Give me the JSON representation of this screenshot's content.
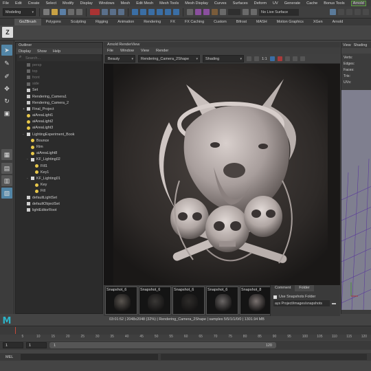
{
  "menubar": {
    "items": [
      "File",
      "Edit",
      "Create",
      "Select",
      "Modify",
      "Display",
      "Windows",
      "Mesh",
      "Edit Mesh",
      "Mesh Tools",
      "Mesh Display",
      "Curves",
      "Surfaces",
      "Deform",
      "UV",
      "Generate",
      "Cache",
      "Bonus Tools",
      "Arnold",
      "Help"
    ]
  },
  "statusline": {
    "workspace": "Modeling",
    "live_surface": "No Live Surface"
  },
  "shelf": {
    "tabs": [
      "GoZBrush",
      "Polygons",
      "Sculpting",
      "Rigging",
      "Animation",
      "Rendering",
      "FX",
      "FX Caching",
      "Custom",
      "Bifrost",
      "MASH",
      "Motion Graphics",
      "XGen",
      "Arnold"
    ],
    "active_tab": "GoZBrush"
  },
  "outliner": {
    "title": "Outliner",
    "menu": [
      "Display",
      "Show",
      "Help"
    ],
    "search_placeholder": "Search...",
    "items": [
      {
        "label": "persp",
        "dim": true,
        "indent": 0,
        "icon": "camera"
      },
      {
        "label": "top",
        "dim": true,
        "indent": 0,
        "icon": "camera"
      },
      {
        "label": "front",
        "dim": true,
        "indent": 0,
        "icon": "camera"
      },
      {
        "label": "side",
        "dim": true,
        "indent": 0,
        "icon": "camera"
      },
      {
        "label": "Set",
        "dim": false,
        "indent": 0,
        "icon": "set"
      },
      {
        "label": "Rendering_Camera1",
        "dim": false,
        "indent": 0,
        "icon": "camera"
      },
      {
        "label": "Rendering_Camera_2",
        "dim": false,
        "indent": 0,
        "icon": "camera"
      },
      {
        "label": "Final_Project",
        "dim": false,
        "indent": 0,
        "icon": "group",
        "expand": "+"
      },
      {
        "label": "aiAreaLight1",
        "dim": false,
        "indent": 0,
        "icon": "light"
      },
      {
        "label": "aiAreaLight2",
        "dim": false,
        "indent": 0,
        "icon": "light"
      },
      {
        "label": "aiAreaLight3",
        "dim": false,
        "indent": 0,
        "icon": "light"
      },
      {
        "label": "LightingExperiment_Book",
        "dim": false,
        "indent": 0,
        "icon": "group",
        "expand": "-"
      },
      {
        "label": "Bounce",
        "dim": false,
        "indent": 1,
        "icon": "light"
      },
      {
        "label": "Rim",
        "dim": false,
        "indent": 1,
        "icon": "light"
      },
      {
        "label": "aiAreaLight8",
        "dim": false,
        "indent": 1,
        "icon": "light"
      },
      {
        "label": "KF_Lighting02",
        "dim": false,
        "indent": 1,
        "icon": "group",
        "expand": "-"
      },
      {
        "label": "Fill1",
        "dim": false,
        "indent": 2,
        "icon": "light"
      },
      {
        "label": "Key1",
        "dim": false,
        "indent": 2,
        "icon": "light"
      },
      {
        "label": "KF_Lighting01",
        "dim": false,
        "indent": 1,
        "icon": "group",
        "expand": "-"
      },
      {
        "label": "Key",
        "dim": false,
        "indent": 2,
        "icon": "light"
      },
      {
        "label": "Fill",
        "dim": false,
        "indent": 2,
        "icon": "light"
      },
      {
        "label": "defaultLightSet",
        "dim": false,
        "indent": 0,
        "icon": "set"
      },
      {
        "label": "defaultObjectSet",
        "dim": false,
        "indent": 0,
        "icon": "set"
      },
      {
        "label": "lightEditorRoot",
        "dim": false,
        "indent": 0,
        "icon": "set"
      }
    ]
  },
  "renderview": {
    "title": "Arnold RenderView",
    "menu": [
      "File",
      "Window",
      "View",
      "Render"
    ],
    "aov": "Beauty",
    "camera": "Rendering_Camera_2Shape",
    "shading": "Shading",
    "zoom_label": "1:1",
    "snapshots": [
      {
        "label": "Snapshot_6"
      },
      {
        "label": "Snapshot_6"
      },
      {
        "label": "Snapshot_6"
      },
      {
        "label": "Snapshot_6"
      },
      {
        "label": "Snapshot_8"
      }
    ],
    "snapshot_tabs": [
      "Comment",
      "Folder"
    ],
    "use_snapshots_folder": "Use Snapshots Folder",
    "folder_path": "ays Project/images/snapshots",
    "status": "03:01:52 | 2048x2048 (32%) | Rendering_Camera_2Shape | samples 5/5/1/1/0/0 | 1301.94 MB"
  },
  "attribute_editor": {
    "tabs": [
      "View",
      "Shading"
    ],
    "fields": [
      "Verts:",
      "Edges:",
      "Faces:",
      "Tris:",
      "UVs:"
    ]
  },
  "timeslider": {
    "ticks": [
      "5",
      "10",
      "15",
      "20",
      "25",
      "30",
      "35",
      "40",
      "45",
      "50",
      "55",
      "60",
      "65",
      "70",
      "75",
      "80",
      "85",
      "90",
      "95",
      "100",
      "105",
      "110",
      "115",
      "120"
    ]
  },
  "rangebar": {
    "start": "1",
    "current": "1",
    "range_start": "1",
    "range_end": "120"
  },
  "mel": {
    "label": "MEL"
  },
  "colors": {
    "accent_blue": "#5285a6",
    "arnold_green": "#5aa03c",
    "maya_logo": "#2db2c6",
    "light_icon": "#e8c84a"
  }
}
